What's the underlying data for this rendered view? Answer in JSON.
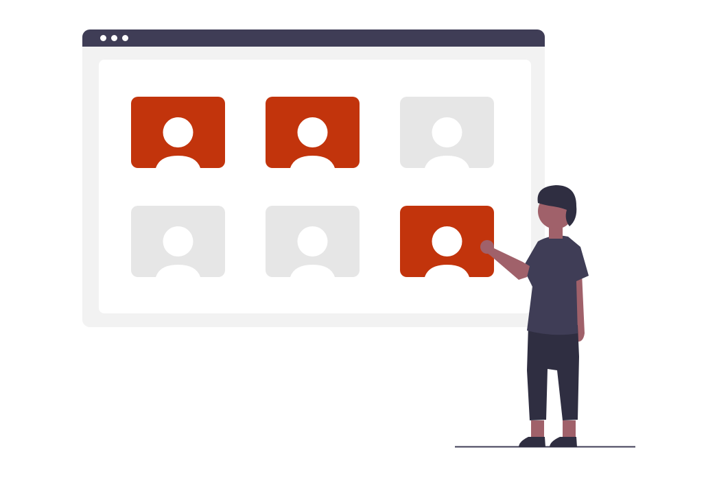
{
  "colors": {
    "selected": "#c2340c",
    "unselected": "#e6e6e6",
    "frame_dark": "#3f3d56",
    "window_bg": "#f2f2f2",
    "skin": "#a0616a",
    "pants": "#2f2e41"
  },
  "window": {
    "controls": [
      "dot",
      "dot",
      "dot"
    ]
  },
  "profiles": [
    {
      "icon": "user-icon",
      "selected": true
    },
    {
      "icon": "user-icon",
      "selected": true
    },
    {
      "icon": "user-icon",
      "selected": false
    },
    {
      "icon": "user-icon",
      "selected": false
    },
    {
      "icon": "user-icon",
      "selected": false
    },
    {
      "icon": "user-icon",
      "selected": true
    }
  ]
}
